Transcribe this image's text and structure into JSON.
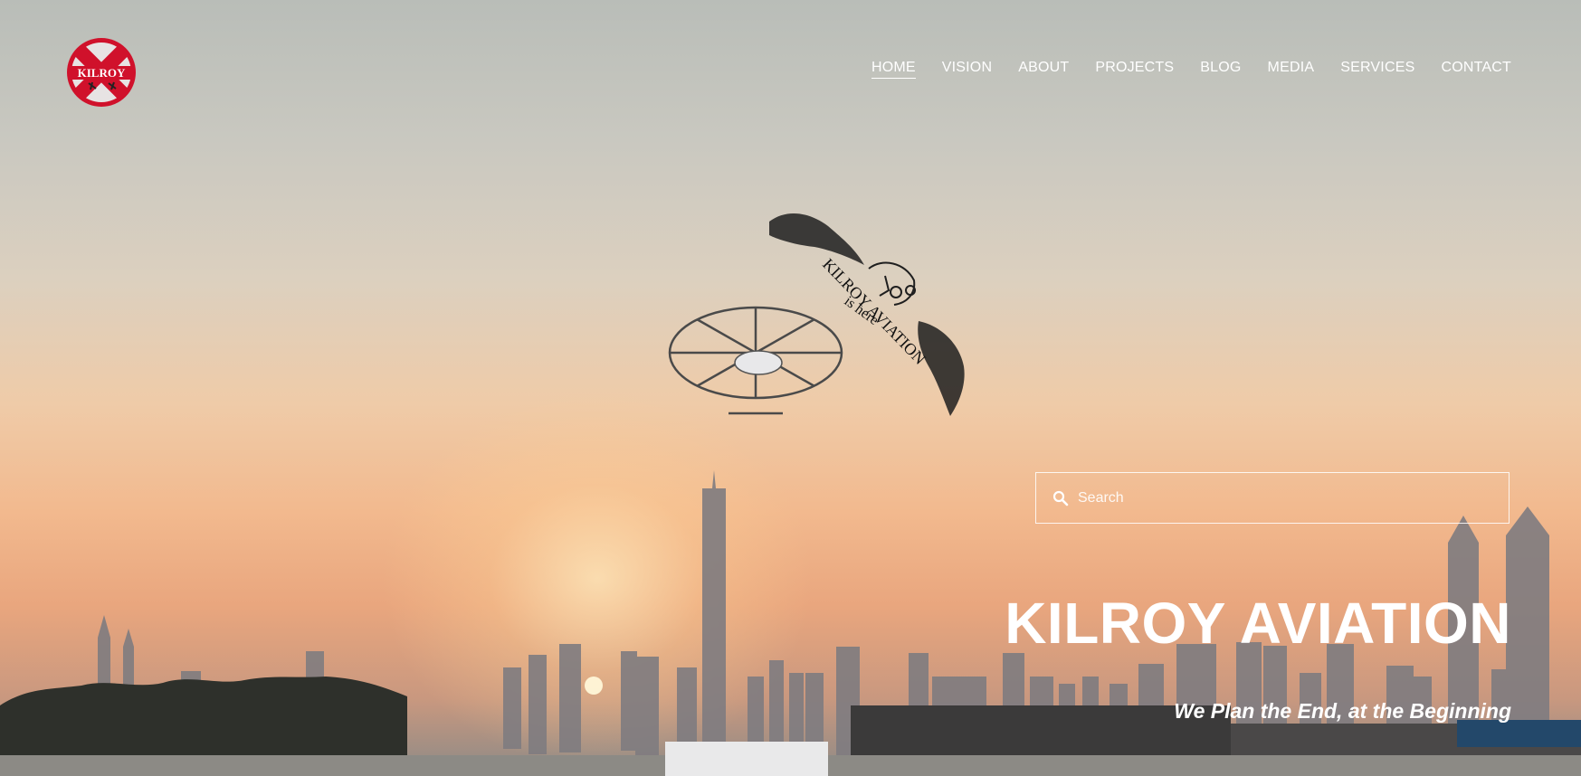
{
  "brand": {
    "logo_text": "KILROY",
    "logo_color": "#d0112b"
  },
  "nav": {
    "items": [
      {
        "label": "HOME",
        "active": true
      },
      {
        "label": "VISION"
      },
      {
        "label": "ABOUT"
      },
      {
        "label": "PROJECTS"
      },
      {
        "label": "BLOG"
      },
      {
        "label": "MEDIA"
      },
      {
        "label": "SERVICES"
      },
      {
        "label": "CONTACT"
      }
    ]
  },
  "emblem": {
    "line1": "KILROY AVIATION",
    "line2": "is here"
  },
  "search": {
    "placeholder": "Search",
    "value": ""
  },
  "hero": {
    "title": "KILROY AVIATION",
    "subtitle": "We Plan the End, at the Beginning"
  }
}
